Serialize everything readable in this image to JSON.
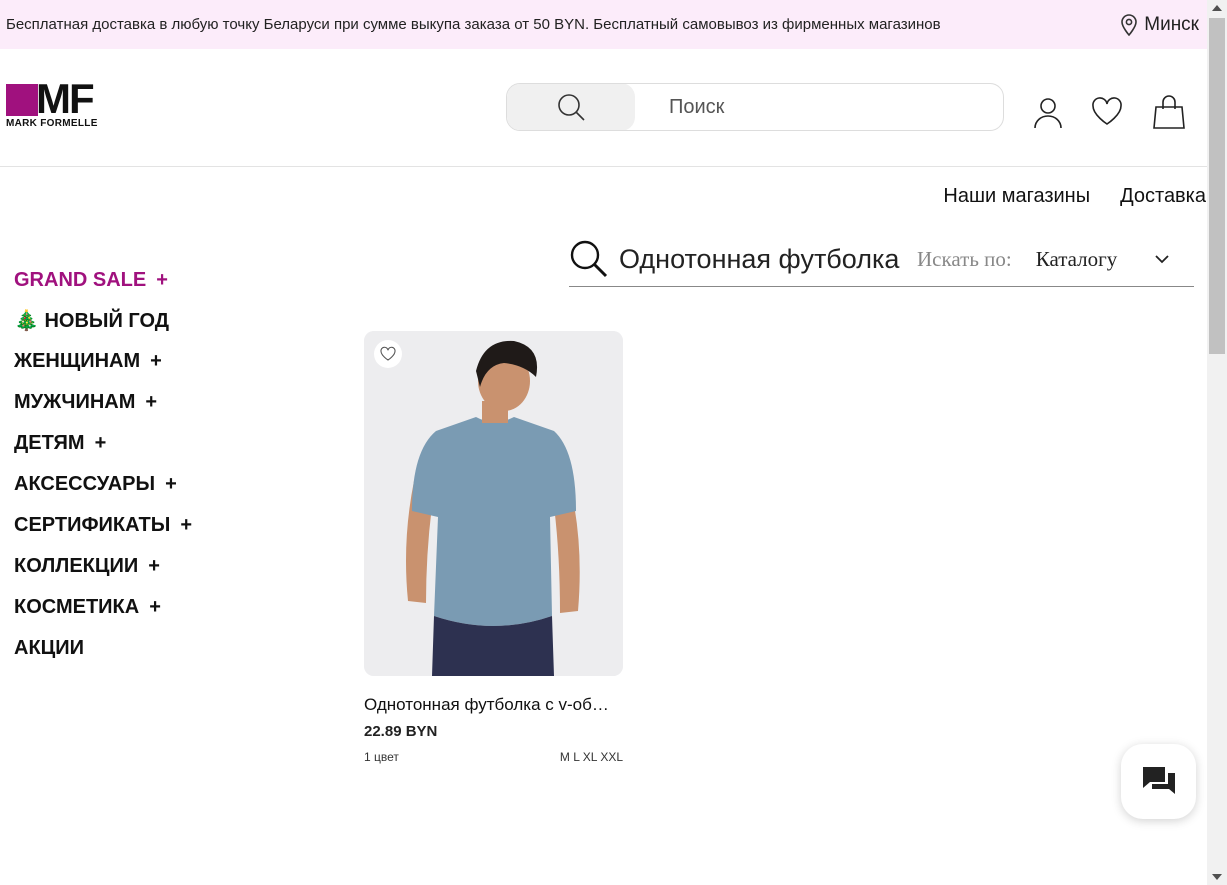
{
  "promo": {
    "text": "Бесплатная доставка в любую точку Беларуси при сумме выкупа заказа от 50 BYN. Бесплатный самовывоз из фирменных магазинов",
    "city": "Минск"
  },
  "logo": {
    "letters": "MF",
    "text": "MARK FORMELLE",
    "brand_color": "#a0117e"
  },
  "header": {
    "search_placeholder": "Поиск",
    "icons": [
      "search-icon",
      "user-icon",
      "heart-icon",
      "bag-icon"
    ]
  },
  "top_links": [
    "Наши магазины",
    "Доставка"
  ],
  "sidebar": {
    "items": [
      {
        "label": "GRAND SALE",
        "plus": "+"
      },
      {
        "label": "🎄 НОВЫЙ ГОД",
        "plus": ""
      },
      {
        "label": "ЖЕНЩИНАМ",
        "plus": "+"
      },
      {
        "label": "МУЖЧИНАМ",
        "plus": "+"
      },
      {
        "label": "ДЕТЯМ",
        "plus": "+"
      },
      {
        "label": "АКСЕССУАРЫ",
        "plus": "+"
      },
      {
        "label": "СЕРТИФИКАТЫ",
        "plus": "+"
      },
      {
        "label": "КОЛЛЕКЦИИ",
        "plus": "+"
      },
      {
        "label": "КОСМЕТИКА",
        "plus": "+"
      },
      {
        "label": "АКЦИИ",
        "plus": ""
      }
    ]
  },
  "search_bar": {
    "query": "Однотонная футболка",
    "by_label": "Искать по:",
    "scope": "Каталогу"
  },
  "product": {
    "title": "Однотонная футболка с v-об…",
    "price": "22.89 BYN",
    "colors": "1 цвет",
    "sizes": "M L XL XXL"
  }
}
